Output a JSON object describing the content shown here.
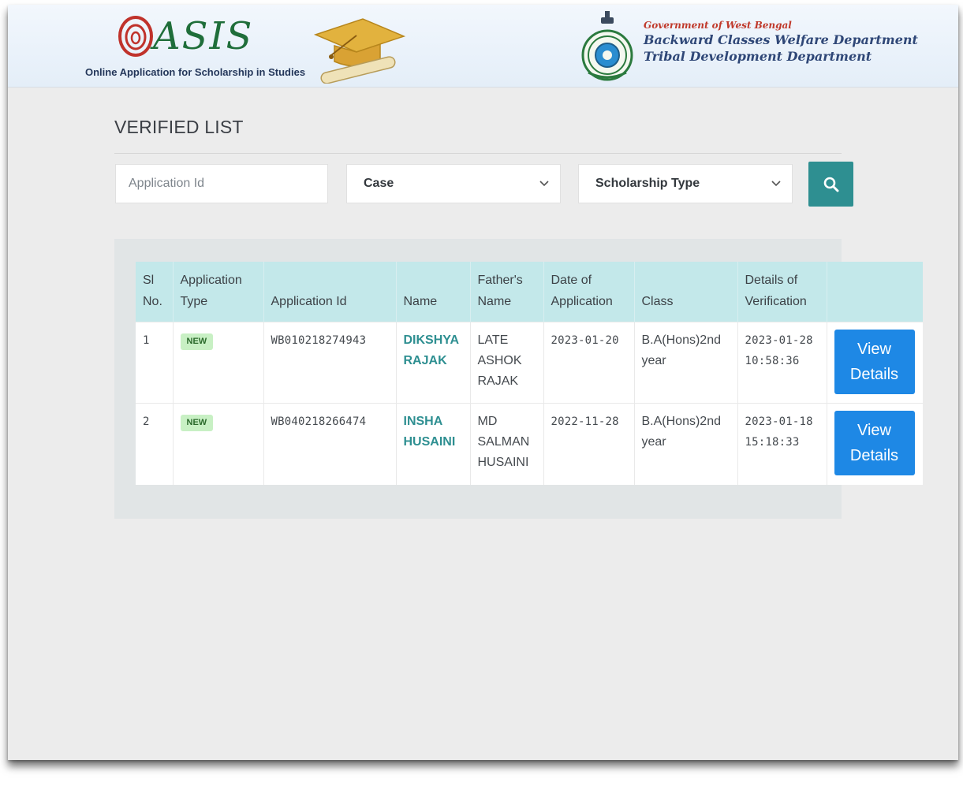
{
  "header": {
    "logo_word": "ASIS",
    "logo_tagline": "Online Application for Scholarship in Studies",
    "gov_line1": "Government of West Bengal",
    "gov_line2": "Backward Classes Welfare Department",
    "gov_line3": "Tribal Development Department"
  },
  "page": {
    "title": "VERIFIED LIST"
  },
  "filters": {
    "application_id_placeholder": "Application Id",
    "application_id_value": "",
    "case_selected": "Case",
    "scholarship_type_selected": "Scholarship Type",
    "search_icon": "search-icon"
  },
  "table": {
    "headers": {
      "sl_no": "Sl No.",
      "application_type": "Application Type",
      "application_id": "Application Id",
      "name": "Name",
      "fathers_name": "Father's Name",
      "date_of_application": "Date of Application",
      "class": "Class",
      "details_of_verification": "Details of Verification"
    },
    "rows": [
      {
        "sl_no": "1",
        "application_type": "NEW",
        "application_id": "WB010218274943",
        "name": "DIKSHYA RAJAK",
        "fathers_name": "LATE ASHOK RAJAK",
        "date_of_application": "2023-01-20",
        "class": "B.A(Hons)2nd year",
        "details_of_verification": "2023-01-28 10:58:36",
        "action_label": "View Details"
      },
      {
        "sl_no": "2",
        "application_type": "NEW",
        "application_id": "WB040218266474",
        "name": "INSHA HUSAINI",
        "fathers_name": "MD SALMAN HUSAINI",
        "date_of_application": "2022-11-28",
        "class": "B.A(Hons)2nd year",
        "details_of_verification": "2023-01-18 15:18:33",
        "action_label": "View Details"
      }
    ]
  },
  "colors": {
    "accent_teal": "#2e8f91",
    "button_blue": "#1e88e5",
    "header_row": "#c3e8ea",
    "badge_green": "#c8f0c4"
  }
}
